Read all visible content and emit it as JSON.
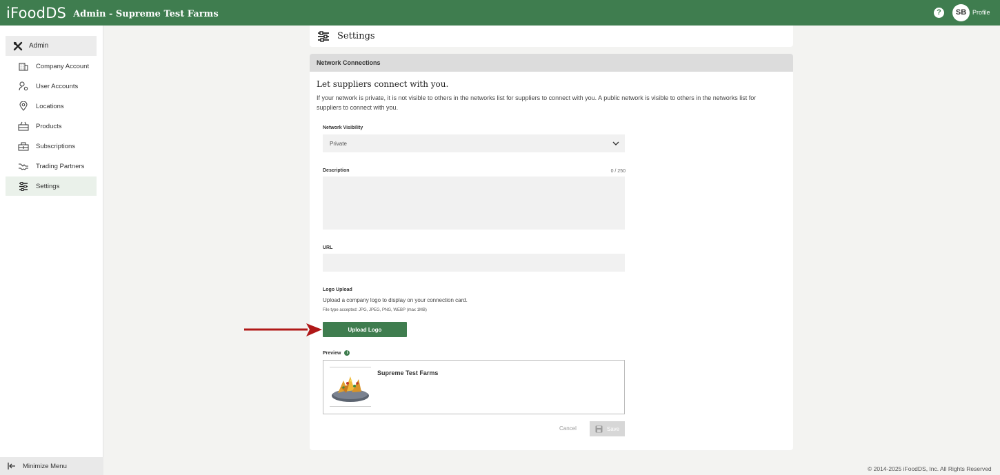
{
  "header": {
    "brand": "iFoodDS",
    "title": "Admin - Supreme Test Farms",
    "help": "?",
    "avatar_initials": "SB",
    "profile_label": "Profile",
    "brand_color": "#3f7d4f"
  },
  "sidebar": {
    "section_label": "Admin",
    "items": [
      {
        "label": "Company Account",
        "icon": "building-icon"
      },
      {
        "label": "User Accounts",
        "icon": "user-gear-icon"
      },
      {
        "label": "Locations",
        "icon": "map-pin-icon"
      },
      {
        "label": "Products",
        "icon": "crate-icon"
      },
      {
        "label": "Subscriptions",
        "icon": "subscription-icon"
      },
      {
        "label": "Trading Partners",
        "icon": "handshake-icon"
      },
      {
        "label": "Settings",
        "icon": "sliders-icon",
        "active": true
      }
    ],
    "minimize_label": "Minimize Menu"
  },
  "settings_card": {
    "title": "Settings"
  },
  "network": {
    "section_header": "Network Connections",
    "heading": "Let suppliers connect with you.",
    "description": "If your network is private, it is not visible to others in the networks list for suppliers to connect with you. A public network is visible to others in the networks list for suppliers to connect with you.",
    "visibility_label": "Network Visibility",
    "visibility_value": "Private",
    "description_label": "Description",
    "description_counter": "0 / 250",
    "url_label": "URL",
    "logo_label": "Logo Upload",
    "logo_help": "Upload a company logo to display on your connection card.",
    "logo_types": "File type accepted: JPG, JPEG, PNG, WEBP (max 1MB)",
    "upload_button": "Upload Logo",
    "preview_label": "Preview",
    "preview_info": "i",
    "preview_company": "Supreme Test Farms",
    "cancel_button": "Cancel",
    "save_button": "Save"
  },
  "footer": {
    "copyright": "© 2014-2025 iFoodDS, Inc. All Rights Reserved"
  }
}
